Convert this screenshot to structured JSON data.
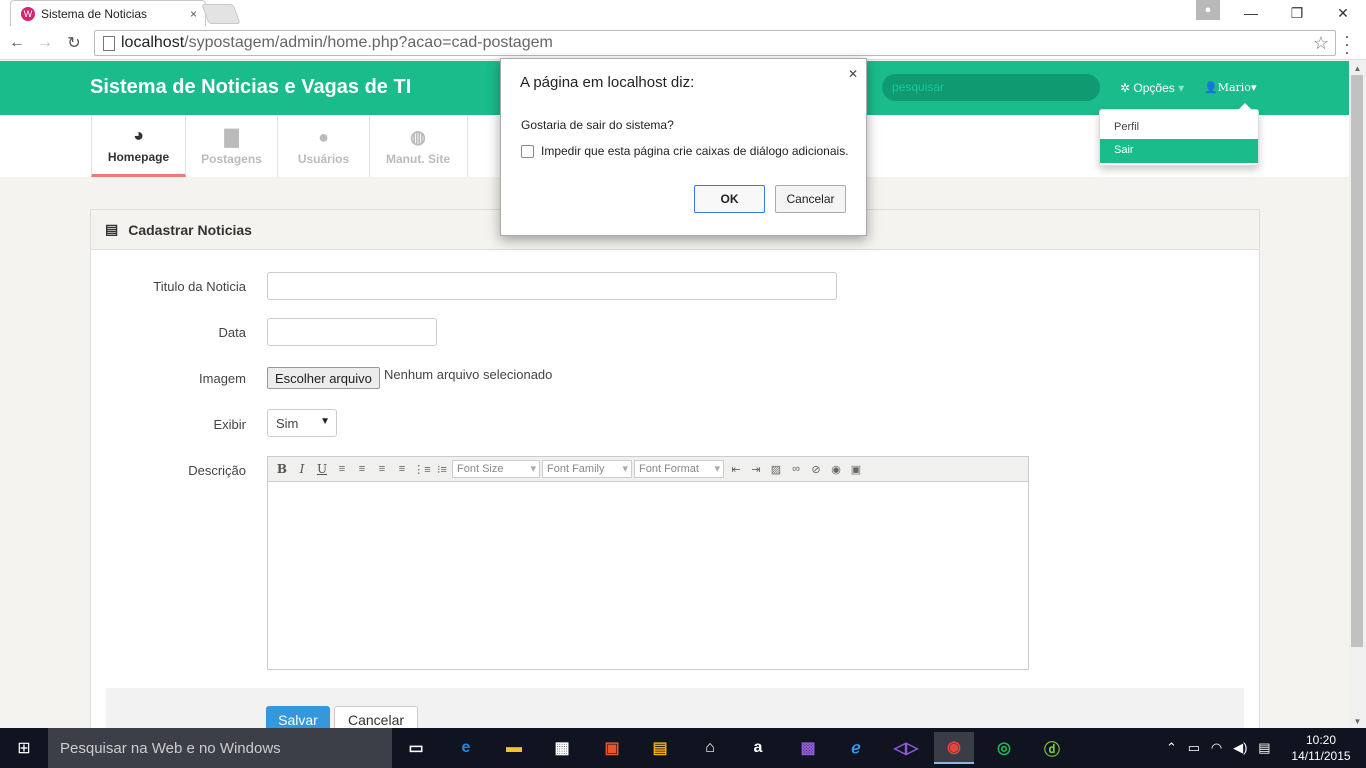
{
  "browser": {
    "tab_title": "Sistema de Noticias",
    "tab_close": "×",
    "url_host": "localhost",
    "url_path": "/sypostagem/admin/home.php?acao=cad-postagem"
  },
  "app": {
    "brand": "Sistema de Noticias e Vagas de TI",
    "search_placeholder": "pesquisar",
    "opcoes_label": "Opções",
    "user_label": "Mario",
    "user_menu": [
      "Perfil",
      "Sair"
    ],
    "nav": [
      {
        "label": "Homepage",
        "icon": "dashboard-icon",
        "active": true
      },
      {
        "label": "Postagens",
        "icon": "file-icon",
        "active": false
      },
      {
        "label": "Usuários",
        "icon": "user-icon",
        "active": false
      },
      {
        "label": "Manut. Site",
        "icon": "globe-icon",
        "active": false
      }
    ]
  },
  "panel": {
    "title": "Cadastrar Noticias",
    "fields": {
      "titulo_label": "Titulo da Noticia",
      "data_label": "Data",
      "imagem_label": "Imagem",
      "file_button": "Escolher arquivo",
      "file_status": "Nenhum arquivo selecionado",
      "exibir_label": "Exibir",
      "exibir_value": "Sim",
      "descricao_label": "Descrição"
    },
    "editor_toolbar": {
      "font_size": "Font Size",
      "font_family": "Font Family",
      "font_format": "Font Format"
    },
    "save_label": "Salvar",
    "cancel_label": "Cancelar"
  },
  "dialog": {
    "title": "A página em localhost diz:",
    "message": "Gostaria de sair do sistema?",
    "checkbox_label": "Impedir que esta página crie caixas de diálogo adicionais.",
    "ok_label": "OK",
    "cancel_label": "Cancelar"
  },
  "taskbar": {
    "search_placeholder": "Pesquisar na Web e no Windows",
    "time": "10:20",
    "date": "14/11/2015"
  },
  "colors": {
    "brand_green": "#1abc8c",
    "primary_blue": "#3498db",
    "active_tab_underline": "#e87e73"
  }
}
